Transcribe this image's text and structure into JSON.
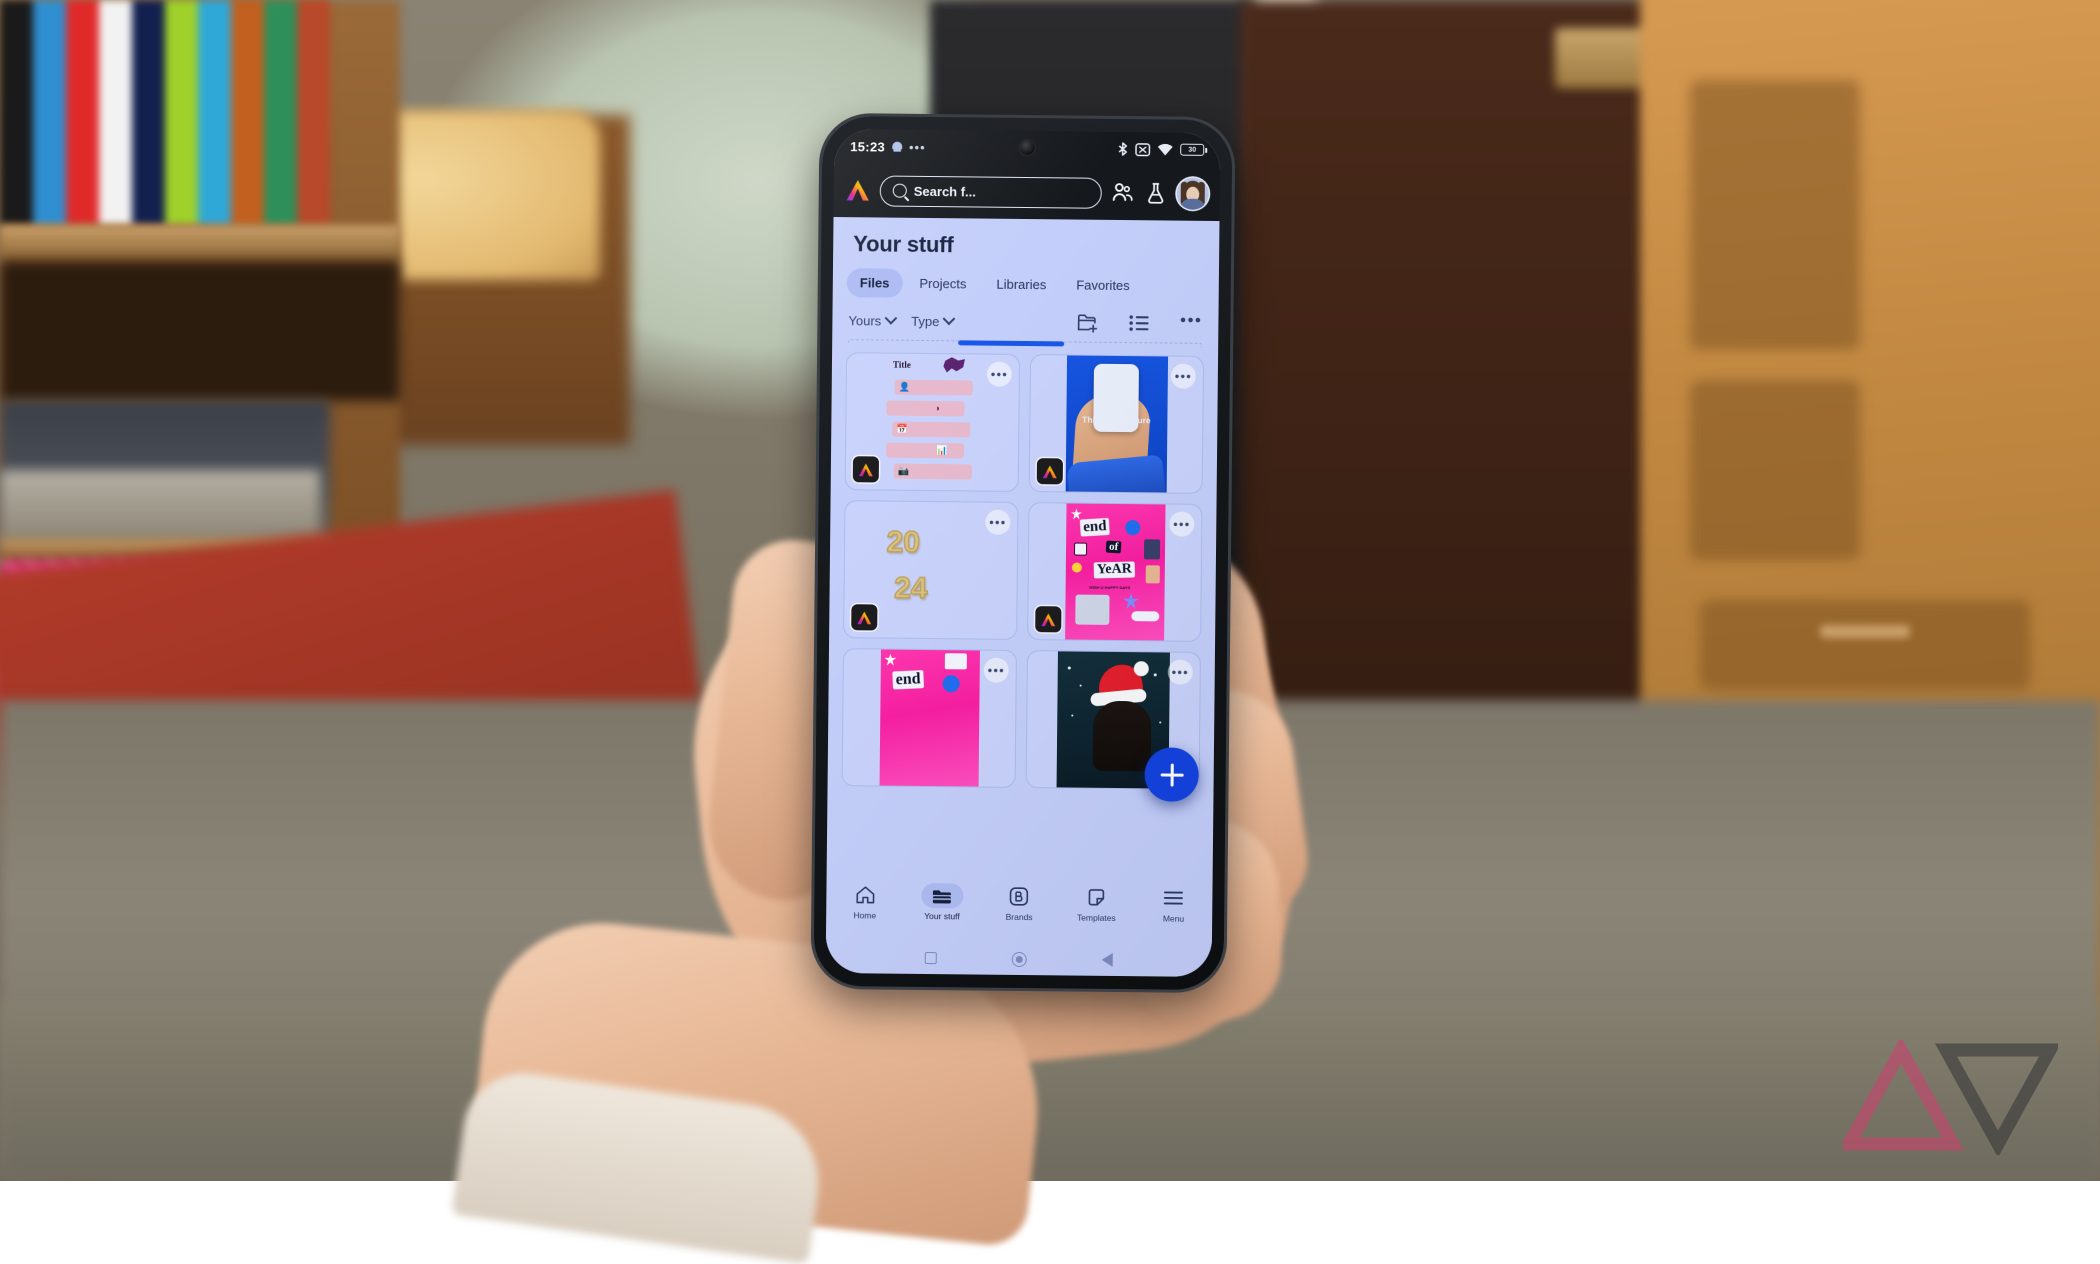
{
  "scene": {
    "description": "Hand holding an Android phone in a bedroom, bookshelf and wardrobe blurred behind",
    "watermark": "android-police-logo"
  },
  "phone": {
    "statusbar": {
      "time": "15:23",
      "notification_icon": "bell-icon",
      "overflow_icon": "more-notifications-icon",
      "right_icons": [
        "bluetooth-icon",
        "mute-icon",
        "wifi-icon",
        "battery-icon"
      ],
      "battery_level": "30"
    },
    "appbar": {
      "logo": "adobe-express-logo",
      "search_placeholder": "Search f...",
      "search_icon": "search-icon",
      "collaborate_icon": "people-icon",
      "labs_icon": "flask-icon",
      "avatar": "user-avatar"
    },
    "page": {
      "title": "Your stuff",
      "tabs": [
        {
          "label": "Files",
          "active": true
        },
        {
          "label": "Projects",
          "active": false
        },
        {
          "label": "Libraries",
          "active": false
        },
        {
          "label": "Favorites",
          "active": false
        }
      ],
      "filters": [
        {
          "label": "Yours",
          "icon": "chevron-down-icon"
        },
        {
          "label": "Type",
          "icon": "chevron-down-icon"
        }
      ],
      "filter_actions": [
        {
          "icon": "new-folder-icon",
          "name": "new-folder"
        },
        {
          "icon": "list-view-icon",
          "name": "list-view"
        },
        {
          "icon": "more-options-icon",
          "name": "more-options"
        }
      ],
      "cards": [
        {
          "name": "title-document",
          "kind": "document",
          "title_text": "Title",
          "badge": "adobe-express-badge",
          "more": "•••"
        },
        {
          "name": "this-is-the-future",
          "kind": "photo",
          "caption": "This is the future",
          "badge": "adobe-express-badge",
          "more": "•••"
        },
        {
          "name": "year-2024-balloons",
          "kind": "graphic",
          "line1": "20",
          "line2": "24",
          "badge": "adobe-express-badge",
          "more": "•••"
        },
        {
          "name": "end-of-year-collage",
          "kind": "collage",
          "word1": "end",
          "word2": "of",
          "word3": "YeAR",
          "badge": "adobe-express-badge",
          "more": "•••"
        },
        {
          "name": "end-of-year-collage-2",
          "kind": "collage",
          "word1": "end",
          "badge": "adobe-express-badge",
          "more": "•••"
        },
        {
          "name": "santa-hat-photo",
          "kind": "photo",
          "badge": "adobe-express-badge",
          "more": "•••"
        }
      ],
      "fab": {
        "icon": "plus-icon",
        "label": "Create new"
      }
    },
    "bottom_nav": [
      {
        "label": "Home",
        "icon": "home-icon",
        "active": false
      },
      {
        "label": "Your stuff",
        "icon": "folder-icon",
        "active": true
      },
      {
        "label": "Brands",
        "icon": "brands-b-icon",
        "active": false
      },
      {
        "label": "Templates",
        "icon": "templates-icon",
        "active": false
      },
      {
        "label": "Menu",
        "icon": "hamburger-menu-icon",
        "active": false
      }
    ],
    "android_nav": [
      {
        "name": "recents-button",
        "icon": "square-icon"
      },
      {
        "name": "home-button",
        "icon": "circle-icon"
      },
      {
        "name": "back-button",
        "icon": "triangle-icon"
      }
    ]
  },
  "colors": {
    "app_background": "#c3cefa",
    "accent_blue": "#1443e0",
    "status_bar": "#15181c",
    "tab_active": "#abbaf3",
    "collage_pink": "#f71fa2"
  }
}
